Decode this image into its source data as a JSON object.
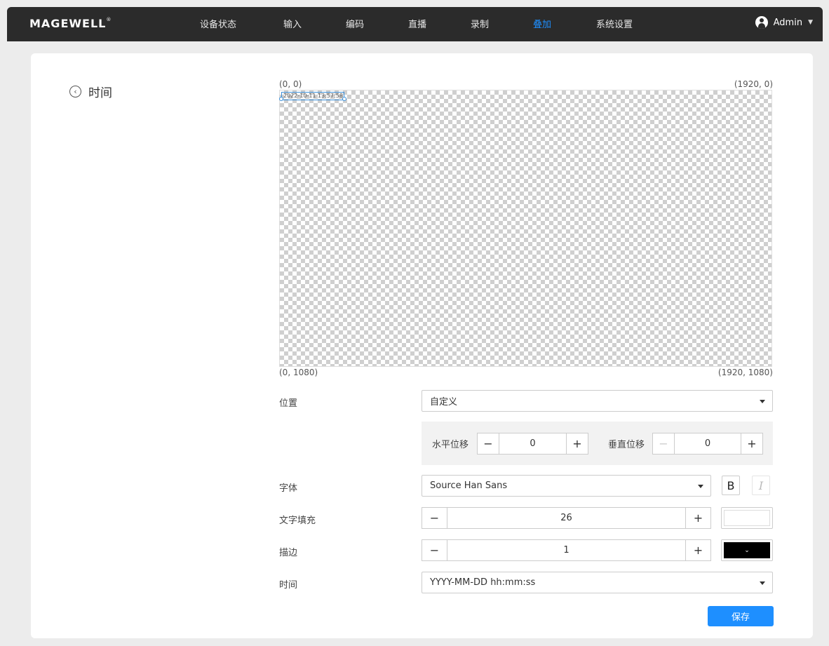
{
  "brand": {
    "logo_text": "MAGEWELL",
    "registered_mark": "®"
  },
  "nav": {
    "items": [
      {
        "label": "设备状态",
        "active": false
      },
      {
        "label": "输入",
        "active": false
      },
      {
        "label": "编码",
        "active": false
      },
      {
        "label": "直播",
        "active": false
      },
      {
        "label": "录制",
        "active": false
      },
      {
        "label": "叠加",
        "active": true
      },
      {
        "label": "系统设置",
        "active": false
      }
    ],
    "user": {
      "name": "Admin",
      "icon": "user-icon"
    }
  },
  "page": {
    "title": "时间",
    "back_icon": "chevron-left-circle-icon"
  },
  "canvas": {
    "top_left": "(0, 0)",
    "top_right": "(1920, 0)",
    "bottom_left": "(0, 1080)",
    "bottom_right": "(1920, 1080)",
    "overlay_text": "2022-10-11 13:57:58"
  },
  "form": {
    "position": {
      "label": "位置",
      "value": "自定义"
    },
    "offset": {
      "horizontal": {
        "label": "水平位移",
        "value": "0",
        "minus": "−",
        "plus": "+"
      },
      "vertical": {
        "label": "垂直位移",
        "value": "0",
        "minus": "−",
        "plus": "+"
      }
    },
    "font": {
      "label": "字体",
      "value": "Source Han Sans",
      "bold": "B",
      "italic": "I"
    },
    "fill": {
      "label": "文字填充",
      "value": "26",
      "minus": "−",
      "plus": "+",
      "color": "#ffffff"
    },
    "stroke": {
      "label": "描边",
      "value": "1",
      "minus": "−",
      "plus": "+",
      "color": "#000000",
      "caret": "⌄"
    },
    "time": {
      "label": "时间",
      "value": "YYYY-MM-DD hh:mm:ss"
    }
  },
  "actions": {
    "save_label": "保存"
  },
  "colors": {
    "accent": "#1e8fff",
    "topbar": "#2b2b2b"
  }
}
